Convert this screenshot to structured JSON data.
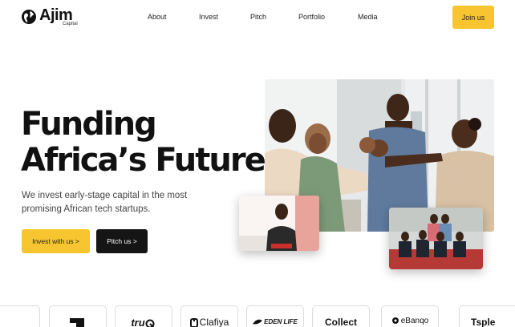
{
  "header": {
    "logo": {
      "name": "Ajim",
      "sub": "Capital"
    },
    "nav": [
      {
        "label": "About"
      },
      {
        "label": "Invest"
      },
      {
        "label": "Pitch"
      },
      {
        "label": "Portfolio"
      },
      {
        "label": "Media"
      }
    ],
    "cta": "Join us"
  },
  "hero": {
    "title_line1": "Funding",
    "title_line2": "Africa’s Future",
    "subtitle": "We invest early-stage capital in the most promising African tech startups.",
    "primary_button": "Invest with us >",
    "secondary_button": "Pitch us >"
  },
  "images": {
    "main": "group-high-five-photo",
    "speaker": "speaker-photo",
    "team": "team-photo"
  },
  "portfolio_logos": [
    {
      "label": ""
    },
    {
      "label": ""
    },
    {
      "label": "tru"
    },
    {
      "label": "Clafiya"
    },
    {
      "label": "EDEN LIFE"
    },
    {
      "label": "Collect"
    },
    {
      "label": "eBanqo"
    },
    {
      "label": "Tsple"
    }
  ],
  "colors": {
    "accent": "#f7c530",
    "dark": "#151515",
    "text": "#111111"
  }
}
